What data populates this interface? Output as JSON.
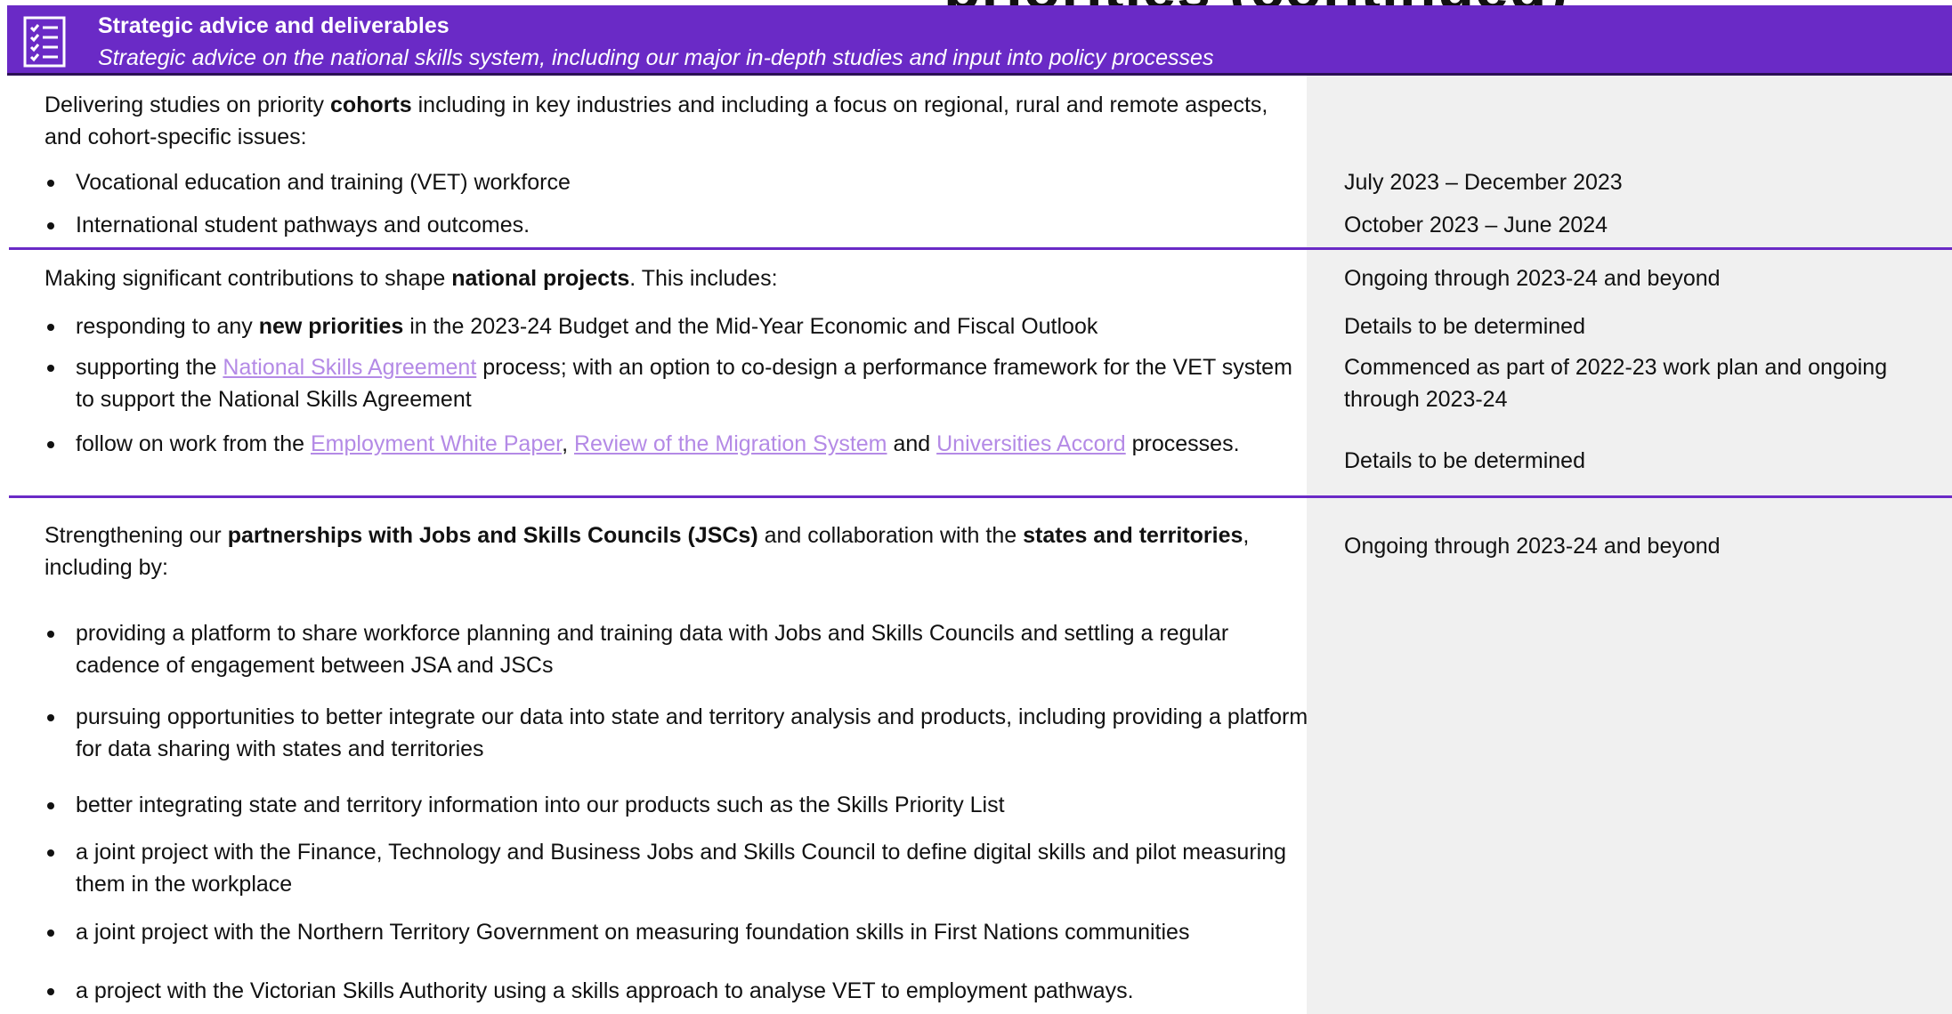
{
  "page": {
    "cut_title": "priorities (continued)"
  },
  "header": {
    "icon": "checklist-icon",
    "title": "Strategic advice and deliverables",
    "subtitle": "Strategic advice on the national skills system, including our major in-depth studies and input into policy processes"
  },
  "colors": {
    "accent": "#6a2ac6",
    "link": "#b48ae6",
    "right_column": "#f0f0f0"
  },
  "section1": {
    "intro_pre": "Delivering studies on priority ",
    "intro_bold": "cohorts",
    "intro_post": " including in key industries and including a focus on regional, rural and remote aspects, and cohort-specific issues:",
    "bullet1": "Vocational education and training (VET) workforce",
    "bullet2": "International student pathways and outcomes.",
    "timing1": "July 2023 – December 2023",
    "timing2": "October 2023 – June 2024"
  },
  "section2": {
    "intro_pre": "Making significant contributions to shape ",
    "intro_bold": "national projects",
    "intro_post": ". This includes:",
    "intro_timing": "Ongoing through 2023-24 and beyond",
    "b1_pre": "responding to any ",
    "b1_bold": "new priorities",
    "b1_post": " in the 2023-24 Budget and the Mid-Year Economic and Fiscal Outlook",
    "b1_timing": "Details to be determined",
    "b2_pre": "supporting the ",
    "b2_link": "National Skills Agreement",
    "b2_post": " process; with an option to co-design a performance framework for the VET system to support the National Skills Agreement",
    "b2_timing": "Commenced as part of 2022-23 work plan and ongoing through 2023-24",
    "b3_pre": "follow on work from the ",
    "b3_link1": "Employment White Paper",
    "b3_sep": ", ",
    "b3_link2": "Review of the Migration System",
    "b3_and": " and ",
    "b3_link3": "Universities Accord",
    "b3_post": " processes.",
    "b3_timing": "Details to be determined"
  },
  "section3": {
    "intro_pre": "Strengthening our ",
    "intro_bold1": "partnerships with Jobs and Skills Councils (JSCs)",
    "intro_mid": " and collaboration with the ",
    "intro_bold2": "states and territories",
    "intro_post": ", including by:",
    "intro_timing": "Ongoing through 2023-24 and beyond",
    "bullets": [
      "providing a platform to share workforce planning and training data with Jobs and Skills Councils and settling a regular cadence of engagement between JSA and JSCs",
      "pursuing opportunities to better integrate our data into state and territory analysis and products, including providing a platform for data sharing with states and territories",
      "better integrating state and territory information into our products such as the Skills Priority List",
      "a joint project with the Finance, Technology and Business Jobs and Skills Council to define digital skills and pilot measuring them in the workplace",
      "a joint project with the Northern Territory Government on measuring foundation skills in First Nations communities",
      "a project with the Victorian Skills Authority using a skills approach to analyse VET to employment pathways."
    ]
  }
}
